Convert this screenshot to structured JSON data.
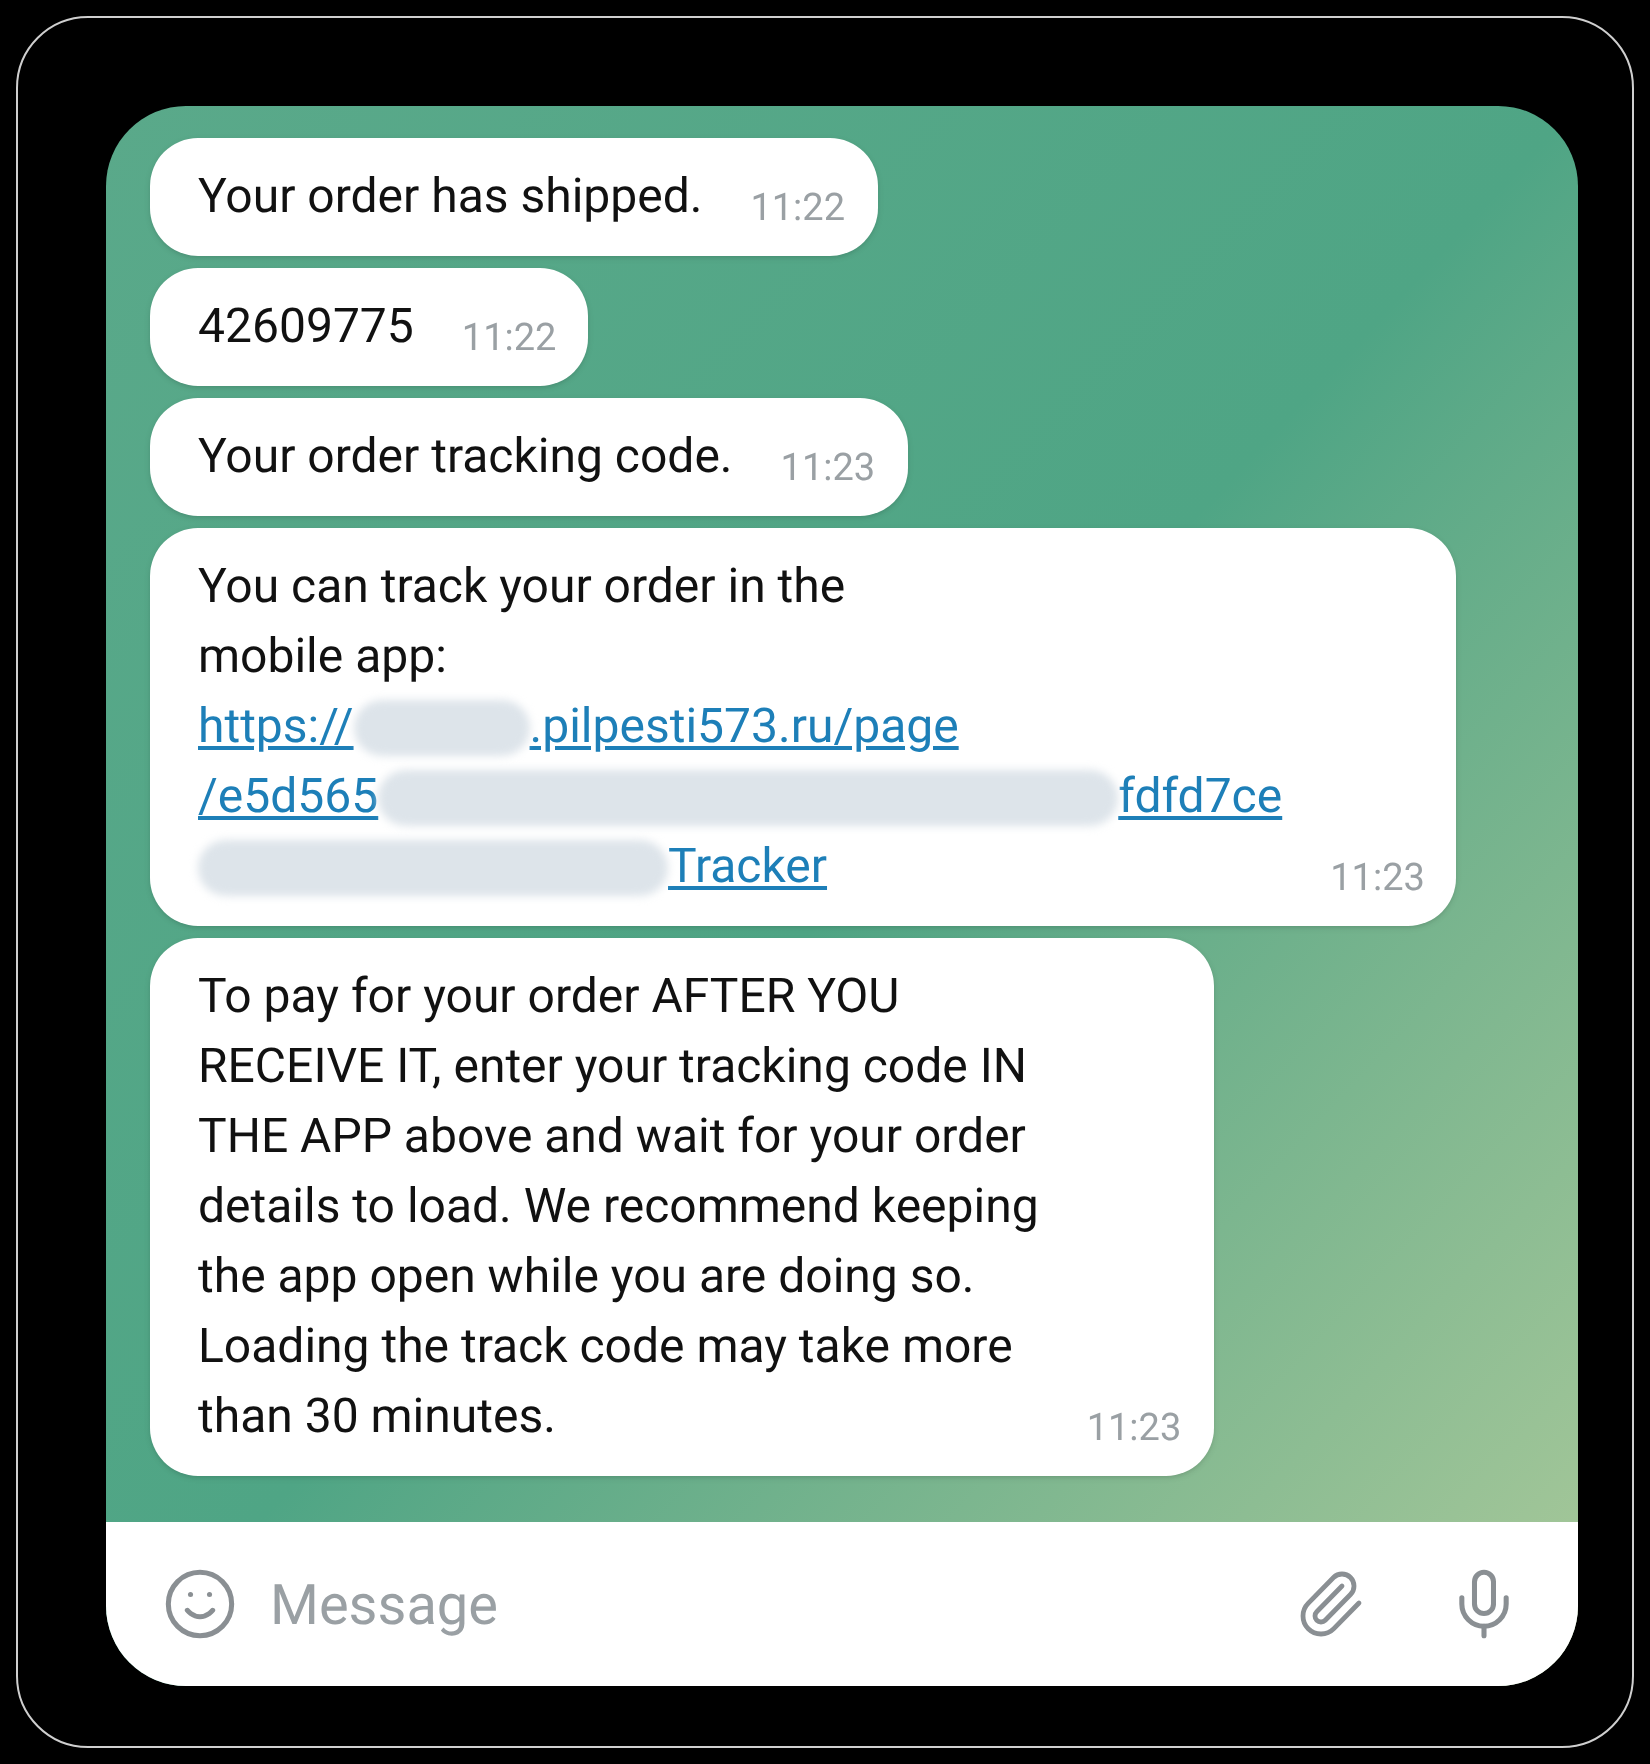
{
  "messages": [
    {
      "kind": "text",
      "lines": [
        "Your order has shipped."
      ],
      "time": "11:22"
    },
    {
      "kind": "text",
      "lines": [
        "42609775"
      ],
      "time": "11:22"
    },
    {
      "kind": "text",
      "lines": [
        "Your order tracking code."
      ],
      "time": "11:23"
    },
    {
      "kind": "link",
      "lines": [
        "You can track your order in the",
        "mobile app:"
      ],
      "link_lines": [
        [
          {
            "kind": "text",
            "text": "https://"
          },
          {
            "kind": "redacted"
          },
          {
            "kind": "text",
            "text": ".pilpesti573.ru/page"
          }
        ],
        [
          {
            "kind": "text",
            "text": "/e5d565"
          },
          {
            "kind": "redacted"
          },
          {
            "kind": "text",
            "text": "fdfd7ce"
          }
        ],
        [
          {
            "kind": "redacted"
          },
          {
            "kind": "text",
            "text": "Tracker"
          }
        ]
      ],
      "time": "11:23"
    },
    {
      "kind": "text",
      "lines": [
        "To pay for your order AFTER YOU",
        "RECEIVE IT, enter your tracking code IN",
        "THE APP above and wait for your order",
        "details to load. We recommend keeping",
        "the app open while you are doing so.",
        "Loading the track code may take more",
        "than 30 minutes."
      ],
      "time": "11:23"
    }
  ],
  "composer": {
    "placeholder": "Message"
  }
}
